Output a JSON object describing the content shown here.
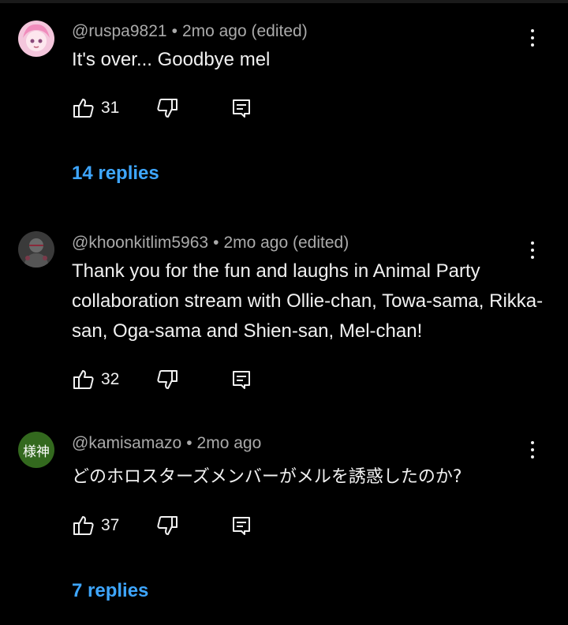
{
  "comments": [
    {
      "username": "@ruspa9821",
      "time": "2mo ago (edited)",
      "text": "It's over... Goodbye mel",
      "likes": "31",
      "replies": "14 replies"
    },
    {
      "username": "@khoonkitlim5963",
      "time": "2mo ago (edited)",
      "text": "Thank you for the fun and laughs in Animal Party collaboration stream with Ollie-chan, Towa-sama, Rikka-san, Oga-sama and Shien-san, Mel-chan!",
      "likes": "32"
    },
    {
      "username": "@kamisamazo",
      "time": "2mo ago",
      "text": "どのホロスターズメンバーがメルを誘惑したのか?",
      "likes": "37",
      "avatar_text": "様神",
      "replies": "7 replies"
    }
  ],
  "separator": "•",
  "colors": {
    "background": "#000000",
    "reply_link": "#3ea6ff",
    "meta": "#aaaaaa",
    "text": "#f1f1f1"
  }
}
